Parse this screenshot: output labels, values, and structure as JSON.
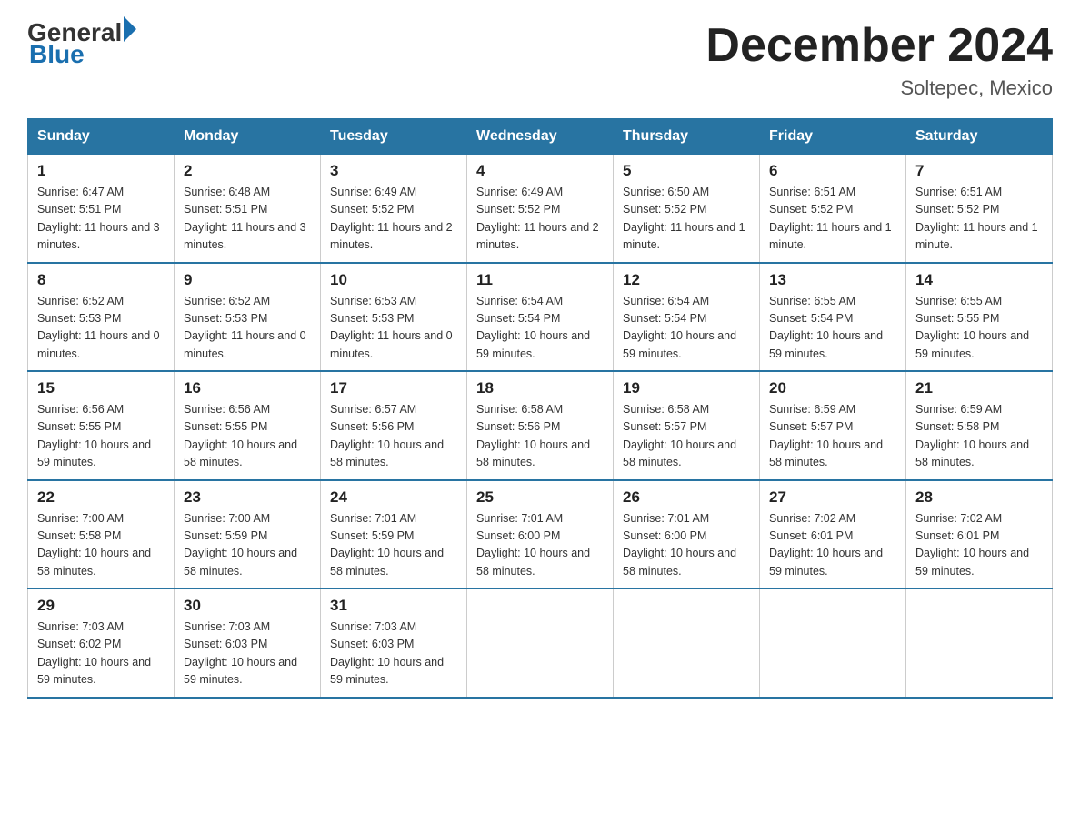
{
  "header": {
    "logo_general": "General",
    "logo_blue": "Blue",
    "month_title": "December 2024",
    "location": "Soltepec, Mexico"
  },
  "days_of_week": [
    "Sunday",
    "Monday",
    "Tuesday",
    "Wednesday",
    "Thursday",
    "Friday",
    "Saturday"
  ],
  "weeks": [
    [
      {
        "date": "1",
        "sunrise": "6:47 AM",
        "sunset": "5:51 PM",
        "daylight": "11 hours and 3 minutes."
      },
      {
        "date": "2",
        "sunrise": "6:48 AM",
        "sunset": "5:51 PM",
        "daylight": "11 hours and 3 minutes."
      },
      {
        "date": "3",
        "sunrise": "6:49 AM",
        "sunset": "5:52 PM",
        "daylight": "11 hours and 2 minutes."
      },
      {
        "date": "4",
        "sunrise": "6:49 AM",
        "sunset": "5:52 PM",
        "daylight": "11 hours and 2 minutes."
      },
      {
        "date": "5",
        "sunrise": "6:50 AM",
        "sunset": "5:52 PM",
        "daylight": "11 hours and 1 minute."
      },
      {
        "date": "6",
        "sunrise": "6:51 AM",
        "sunset": "5:52 PM",
        "daylight": "11 hours and 1 minute."
      },
      {
        "date": "7",
        "sunrise": "6:51 AM",
        "sunset": "5:52 PM",
        "daylight": "11 hours and 1 minute."
      }
    ],
    [
      {
        "date": "8",
        "sunrise": "6:52 AM",
        "sunset": "5:53 PM",
        "daylight": "11 hours and 0 minutes."
      },
      {
        "date": "9",
        "sunrise": "6:52 AM",
        "sunset": "5:53 PM",
        "daylight": "11 hours and 0 minutes."
      },
      {
        "date": "10",
        "sunrise": "6:53 AM",
        "sunset": "5:53 PM",
        "daylight": "11 hours and 0 minutes."
      },
      {
        "date": "11",
        "sunrise": "6:54 AM",
        "sunset": "5:54 PM",
        "daylight": "10 hours and 59 minutes."
      },
      {
        "date": "12",
        "sunrise": "6:54 AM",
        "sunset": "5:54 PM",
        "daylight": "10 hours and 59 minutes."
      },
      {
        "date": "13",
        "sunrise": "6:55 AM",
        "sunset": "5:54 PM",
        "daylight": "10 hours and 59 minutes."
      },
      {
        "date": "14",
        "sunrise": "6:55 AM",
        "sunset": "5:55 PM",
        "daylight": "10 hours and 59 minutes."
      }
    ],
    [
      {
        "date": "15",
        "sunrise": "6:56 AM",
        "sunset": "5:55 PM",
        "daylight": "10 hours and 59 minutes."
      },
      {
        "date": "16",
        "sunrise": "6:56 AM",
        "sunset": "5:55 PM",
        "daylight": "10 hours and 58 minutes."
      },
      {
        "date": "17",
        "sunrise": "6:57 AM",
        "sunset": "5:56 PM",
        "daylight": "10 hours and 58 minutes."
      },
      {
        "date": "18",
        "sunrise": "6:58 AM",
        "sunset": "5:56 PM",
        "daylight": "10 hours and 58 minutes."
      },
      {
        "date": "19",
        "sunrise": "6:58 AM",
        "sunset": "5:57 PM",
        "daylight": "10 hours and 58 minutes."
      },
      {
        "date": "20",
        "sunrise": "6:59 AM",
        "sunset": "5:57 PM",
        "daylight": "10 hours and 58 minutes."
      },
      {
        "date": "21",
        "sunrise": "6:59 AM",
        "sunset": "5:58 PM",
        "daylight": "10 hours and 58 minutes."
      }
    ],
    [
      {
        "date": "22",
        "sunrise": "7:00 AM",
        "sunset": "5:58 PM",
        "daylight": "10 hours and 58 minutes."
      },
      {
        "date": "23",
        "sunrise": "7:00 AM",
        "sunset": "5:59 PM",
        "daylight": "10 hours and 58 minutes."
      },
      {
        "date": "24",
        "sunrise": "7:01 AM",
        "sunset": "5:59 PM",
        "daylight": "10 hours and 58 minutes."
      },
      {
        "date": "25",
        "sunrise": "7:01 AM",
        "sunset": "6:00 PM",
        "daylight": "10 hours and 58 minutes."
      },
      {
        "date": "26",
        "sunrise": "7:01 AM",
        "sunset": "6:00 PM",
        "daylight": "10 hours and 58 minutes."
      },
      {
        "date": "27",
        "sunrise": "7:02 AM",
        "sunset": "6:01 PM",
        "daylight": "10 hours and 59 minutes."
      },
      {
        "date": "28",
        "sunrise": "7:02 AM",
        "sunset": "6:01 PM",
        "daylight": "10 hours and 59 minutes."
      }
    ],
    [
      {
        "date": "29",
        "sunrise": "7:03 AM",
        "sunset": "6:02 PM",
        "daylight": "10 hours and 59 minutes."
      },
      {
        "date": "30",
        "sunrise": "7:03 AM",
        "sunset": "6:03 PM",
        "daylight": "10 hours and 59 minutes."
      },
      {
        "date": "31",
        "sunrise": "7:03 AM",
        "sunset": "6:03 PM",
        "daylight": "10 hours and 59 minutes."
      },
      {
        "date": "",
        "sunrise": "",
        "sunset": "",
        "daylight": ""
      },
      {
        "date": "",
        "sunrise": "",
        "sunset": "",
        "daylight": ""
      },
      {
        "date": "",
        "sunrise": "",
        "sunset": "",
        "daylight": ""
      },
      {
        "date": "",
        "sunrise": "",
        "sunset": "",
        "daylight": ""
      }
    ]
  ],
  "labels": {
    "sunrise": "Sunrise: ",
    "sunset": "Sunset: ",
    "daylight": "Daylight: "
  }
}
